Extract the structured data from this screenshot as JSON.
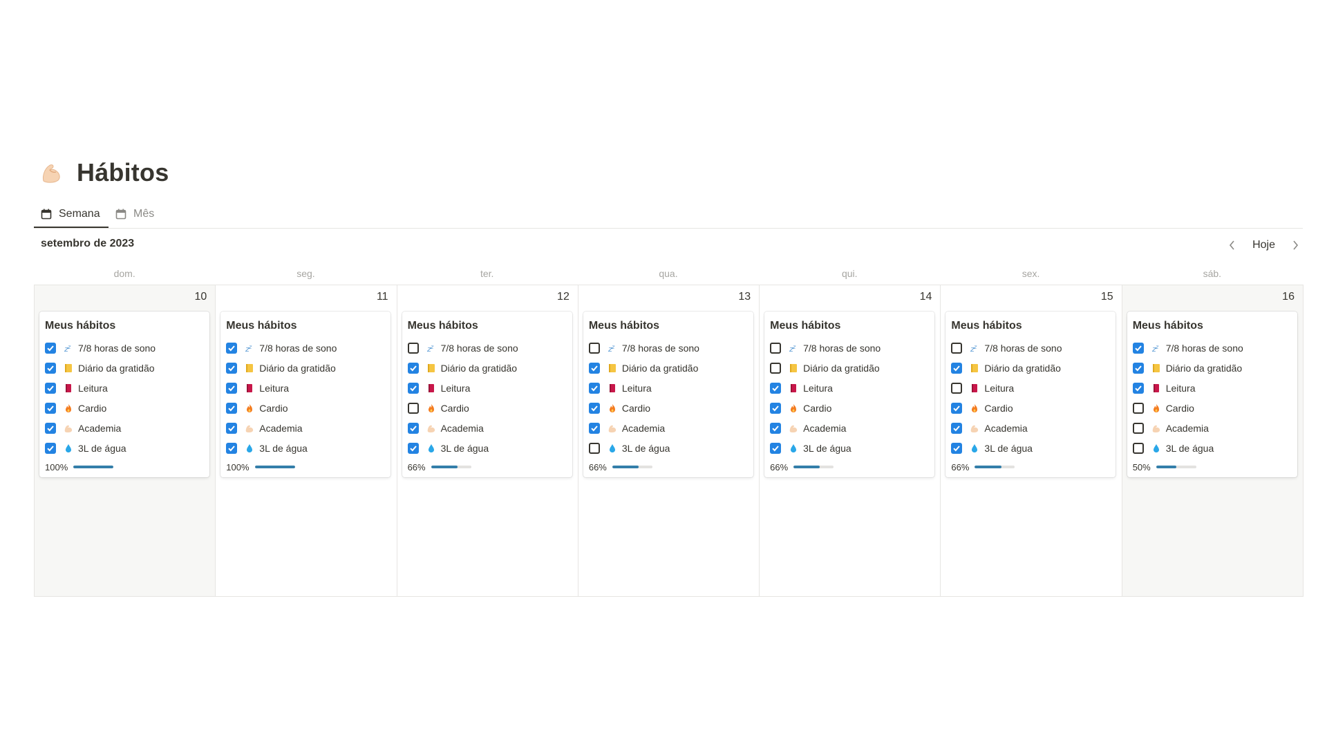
{
  "title": "Hábitos",
  "tabs": [
    {
      "label": "Semana",
      "active": true,
      "icon": "calendar-icon"
    },
    {
      "label": "Mês",
      "active": false,
      "icon": "calendar-icon"
    }
  ],
  "month_label": "setembro de 2023",
  "nav": {
    "prev_icon": "chevron-left-icon",
    "today_label": "Hoje",
    "next_icon": "chevron-right-icon"
  },
  "weekdays": [
    "dom.",
    "seg.",
    "ter.",
    "qua.",
    "qui.",
    "sex.",
    "sáb."
  ],
  "habit_names": [
    "7/8 horas de sono",
    "Diário da gratidão",
    "Leitura",
    "Cardio",
    "Academia",
    "3L de água"
  ],
  "habit_icons": [
    "zzz-icon",
    "notebook-icon",
    "book-icon",
    "fire-icon",
    "flexed-biceps-icon",
    "droplet-icon"
  ],
  "colors": {
    "checkbox_on": "#2383e2",
    "progress_fill": "#337ea9",
    "weekend_bg": "#f7f7f5"
  },
  "days": [
    {
      "date": "10",
      "weekend": true,
      "card_title": "Meus hábitos",
      "checks": [
        true,
        true,
        true,
        true,
        true,
        true
      ],
      "progress_label": "100%",
      "progress": 1.0
    },
    {
      "date": "11",
      "weekend": false,
      "card_title": "Meus hábitos",
      "checks": [
        true,
        true,
        true,
        true,
        true,
        true
      ],
      "progress_label": "100%",
      "progress": 1.0
    },
    {
      "date": "12",
      "weekend": false,
      "card_title": "Meus hábitos",
      "checks": [
        false,
        true,
        true,
        false,
        true,
        true
      ],
      "progress_label": "66%",
      "progress": 0.66
    },
    {
      "date": "13",
      "weekend": false,
      "card_title": "Meus hábitos",
      "checks": [
        false,
        true,
        true,
        true,
        true,
        false
      ],
      "progress_label": "66%",
      "progress": 0.66
    },
    {
      "date": "14",
      "weekend": false,
      "card_title": "Meus hábitos",
      "checks": [
        false,
        false,
        true,
        true,
        true,
        true
      ],
      "progress_label": "66%",
      "progress": 0.66
    },
    {
      "date": "15",
      "weekend": false,
      "card_title": "Meus hábitos",
      "checks": [
        false,
        true,
        false,
        true,
        true,
        true
      ],
      "progress_label": "66%",
      "progress": 0.66
    },
    {
      "date": "16",
      "weekend": true,
      "card_title": "Meus hábitos",
      "checks": [
        true,
        true,
        true,
        false,
        false,
        false
      ],
      "progress_label": "50%",
      "progress": 0.5
    }
  ]
}
